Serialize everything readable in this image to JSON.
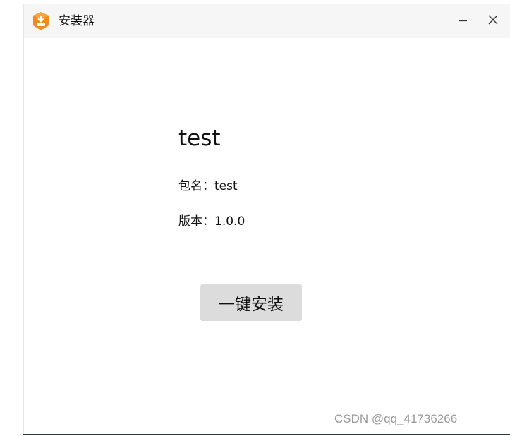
{
  "window": {
    "title": "安装器",
    "app_icon": "installer-box-icon",
    "controls": {
      "minimize_icon": "minimize-icon",
      "close_icon": "close-icon"
    }
  },
  "content": {
    "app_name": "test",
    "package_label": "包名：",
    "package_value": "test",
    "version_label": "版本：",
    "version_value": "1.0.0",
    "install_button": "一键安装"
  },
  "watermark": "CSDN @qq_41736266",
  "colors": {
    "titlebar": "#f6f6f6",
    "icon_orange": "#f08a1c",
    "button_bg": "#dcdcdc",
    "watermark": "#9a9a9a"
  }
}
